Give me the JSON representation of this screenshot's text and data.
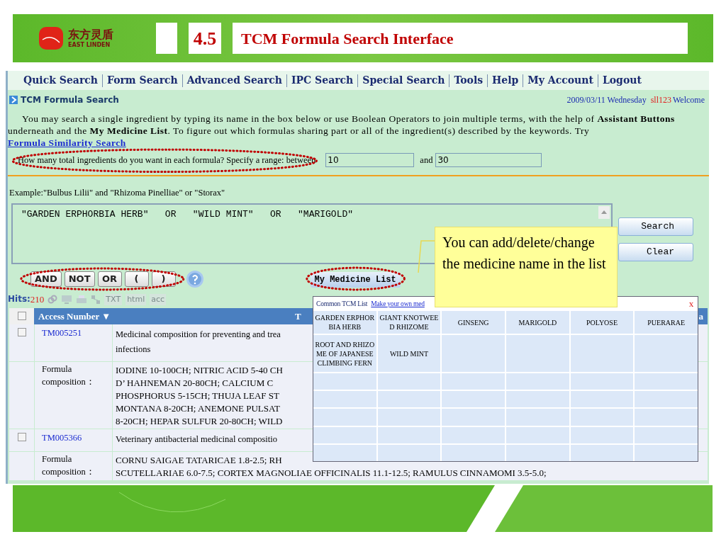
{
  "slide": {
    "logo_chinese": "东方灵盾",
    "logo_english": "EAST LINDEN",
    "section_number": "4.5",
    "title": "TCM Formula Search Interface"
  },
  "nav": [
    "Quick Search",
    "Form Search",
    "Advanced Search",
    "IPC Search",
    "Special Search",
    "Tools",
    "Help",
    "My Account",
    "Logout"
  ],
  "header": {
    "title": "TCM Formula Search",
    "date": "2009/03/11 Wednesday",
    "user": "sll123",
    "welcome": "Welcome"
  },
  "intro": {
    "text": "You may search a single ingredient by typing its name in the box below or use Boolean Operators to join multiple terms, with the help of **Assistant Buttons** underneath and the **My Medicine List**. To figure out which formulas sharing part or all of the ingredient(s) described by the keywords. Try",
    "link": "Formula Similarity Search"
  },
  "range": {
    "label": "How many total ingredients do you want in each formula? Specify a range: between",
    "min": "10",
    "and": "and",
    "max": "30"
  },
  "example": "Example:\"Bulbus Lilii\" and \"Rhizoma Pinelliae\" or \"Storax\"",
  "query": "\"GARDEN ERPHORBIA HERB\"   OR   \"WILD MINT\"   OR   \"MARIGOLD\"",
  "actions": [
    "Search",
    "Clear"
  ],
  "operators": [
    "AND",
    "NOT",
    "OR",
    "(",
    ")"
  ],
  "medicine_list_button": "My Medicine List",
  "hits": {
    "label": "Hits:",
    "count": "210",
    "exports": [
      "TXT",
      "html",
      "acc"
    ]
  },
  "callout": "You can add/delete/change the medicine name in the list",
  "popup": {
    "tabs": [
      {
        "label": "Common TCM List",
        "selected": true
      },
      {
        "label": "Make your own med",
        "selected": false
      }
    ],
    "close": "x",
    "items": [
      "GARDEN ERPHORBIA HERB",
      "GIANT KNOTWEED RHIZOME",
      "GINSENG",
      "MARIGOLD",
      "POLYOSE",
      "PUERARAE",
      "ROOT AND RHIZOME OF JAPANESE CLIMBING FERN",
      "WILD MINT"
    ]
  },
  "table": {
    "select_all": {
      "checked": false
    },
    "columns": [
      "Access Number ▼",
      "T",
      "a"
    ],
    "rows": [
      {
        "access": "TM005251",
        "checked": false,
        "title": [
          "Medicinal composition for preventing and trea",
          "infections"
        ],
        "formula_label": "Formula composition：",
        "formula": [
          "IODINE 10-100CH; NITRIC ACID 5-40 CH",
          "D’  HAHNEMAN 20-80CH; CALCIUM C",
          "PHOSPHORUS 5-15CH; THUJA LEAF ST",
          "MONTANA 8-20CH; ANEMONE PULSAT",
          "8-20CH; HEPAR SULFUR 20-80CH; WILD"
        ]
      },
      {
        "access": "TM005366",
        "checked": false,
        "title": [
          "Veterinary antibacterial medicinal compositio"
        ],
        "formula_label": "Formula composition：",
        "formula": [
          "CORNU SAIGAE TATARICAE 1.8-2.5; RH",
          "SCUTELLARIAE 6.0-7.5; CORTEX MAGNOLIAE OFFICINALIS 11.1-12.5; RAMULUS CINNAMOMI 3.5-5.0;"
        ]
      }
    ]
  }
}
